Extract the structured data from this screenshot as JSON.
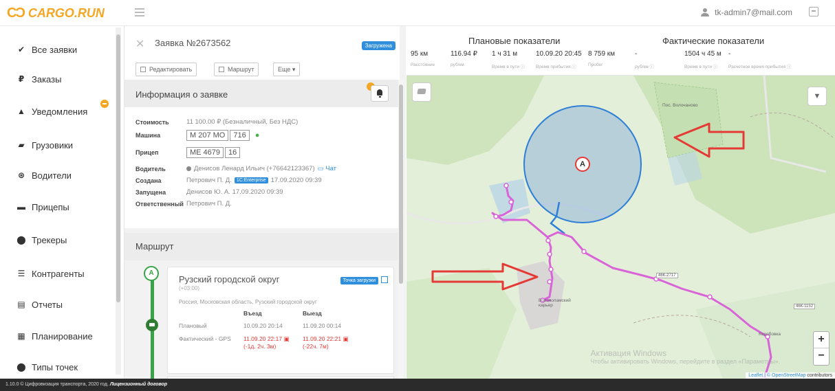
{
  "header": {
    "logo_mark": "CƆ",
    "logo_text": "CARGO.RUN",
    "user_email": "tk-admin7@mail.com"
  },
  "sidebar": {
    "items": [
      {
        "label": "Все заявки",
        "icon": "checklist-icon",
        "glyph": "✔"
      },
      {
        "label": "Заказы",
        "icon": "ruble-icon",
        "glyph": "₽"
      },
      {
        "label": "Уведомления",
        "icon": "bell-icon",
        "glyph": "▲"
      },
      {
        "label": "Грузовики",
        "icon": "truck-icon",
        "glyph": "▰"
      },
      {
        "label": "Водители",
        "icon": "steering-wheel-icon",
        "glyph": "⊛"
      },
      {
        "label": "Прицепы",
        "icon": "trailer-icon",
        "glyph": "▬"
      },
      {
        "label": "Трекеры",
        "icon": "map-pin-icon",
        "glyph": "⬤"
      },
      {
        "label": "Контрагенты",
        "icon": "contacts-icon",
        "glyph": "☰"
      },
      {
        "label": "Отчеты",
        "icon": "report-icon",
        "glyph": "▤"
      },
      {
        "label": "Планирование",
        "icon": "calendar-icon",
        "glyph": "▦"
      },
      {
        "label": "Типы точек",
        "icon": "map-pin-icon",
        "glyph": "⬤"
      }
    ]
  },
  "request": {
    "title": "Заявка №2673562",
    "status": "Загружена",
    "buttons": {
      "edit": "Редактировать",
      "route": "Маршрут",
      "more": "Еще ▾"
    }
  },
  "info": {
    "title": "Информация о заявке",
    "cost_label": "Стоимость",
    "cost_value": "11 100.00 ₽ (Безналичный, Без НДС)",
    "truck_label": "Машина",
    "truck_plate": "M 207 MO",
    "truck_region": "716",
    "trailer_label": "Прицеп",
    "trailer_plate": "ME 4679",
    "trailer_region": "16",
    "driver_label": "Водитель",
    "driver_value": "Денисов Ленард Ильич (+76642123367)",
    "chat_label": "Чат",
    "created_label": "Создана",
    "created_by": "Петрович П. Д.",
    "created_tag": "1С:Enterprise",
    "created_at": "17.09.2020 09:39",
    "started_label": "Запущена",
    "started_value": "Денисов Ю. А. 17.09.2020 09:39",
    "responsible_label": "Ответственный",
    "responsible_value": "Петрович П. Д."
  },
  "route": {
    "title": "Маршрут",
    "point_letter": "A",
    "point_name": "Рузский городской округ",
    "point_tz": "(+03:00)",
    "point_type": "Точка загрузки",
    "point_address": "Россия, Московская область, Рузский городской округ",
    "col_arrive": "Въезд",
    "col_depart": "Выезд",
    "plan_label": "Плановый",
    "plan_arrive": "10.09.20 20:14",
    "plan_depart": "11.09.20 00:14",
    "fact_label": "Фактический - GPS",
    "fact_arrive": "11.09.20 22:17",
    "fact_arrive_delta": "(-1д. 2ч. 3м)",
    "fact_depart": "11.09.20 22:21",
    "fact_depart_delta": "(-22ч. 7м)"
  },
  "stats": {
    "plan_title": "Плановые показатели",
    "fact_title": "Фактические показатели",
    "values": [
      {
        "value": "95 км",
        "label": "Расстояние"
      },
      {
        "value": "116.94 ₽",
        "label": "руб/км"
      },
      {
        "value": "1 ч 31 м",
        "label": "Время в пути ⓘ"
      },
      {
        "value": "10.09.20 20:45",
        "label": "Время прибытия ⓘ"
      },
      {
        "value": "8 759 км",
        "label": "Пробег"
      },
      {
        "value": "-",
        "label": "руб/км ⓘ"
      },
      {
        "value": "1504 ч 45 м",
        "label": "Время в пути ⓘ"
      },
      {
        "value": "-",
        "label": "Расчетное время прибытия ⓘ"
      }
    ]
  },
  "map": {
    "marker_letter": "A",
    "labels": {
      "road1": "46К-1152",
      "road2": "46К-2717",
      "place1": "Волоколамский карьер",
      "place2": "Коробовка",
      "place3": "Пос. Волочаново"
    },
    "attribution_prefix": "Leaflet | ©",
    "attribution_link": "OpenStreetMap",
    "attribution_suffix": "contributors",
    "watermark_title": "Активация Windows",
    "watermark_sub": "Чтобы активировать Windows, перейдите в раздел «Параметры».",
    "filter_glyph": "▼"
  },
  "footer": {
    "text": "1.10.0 © Цифровизация транспорта, 2020 год.",
    "link": "Лицензионный договор"
  },
  "colors": {
    "accent": "#f5a623",
    "route": "#d864d8",
    "geofence": "#2f7fd6",
    "green": "#3aa347"
  }
}
